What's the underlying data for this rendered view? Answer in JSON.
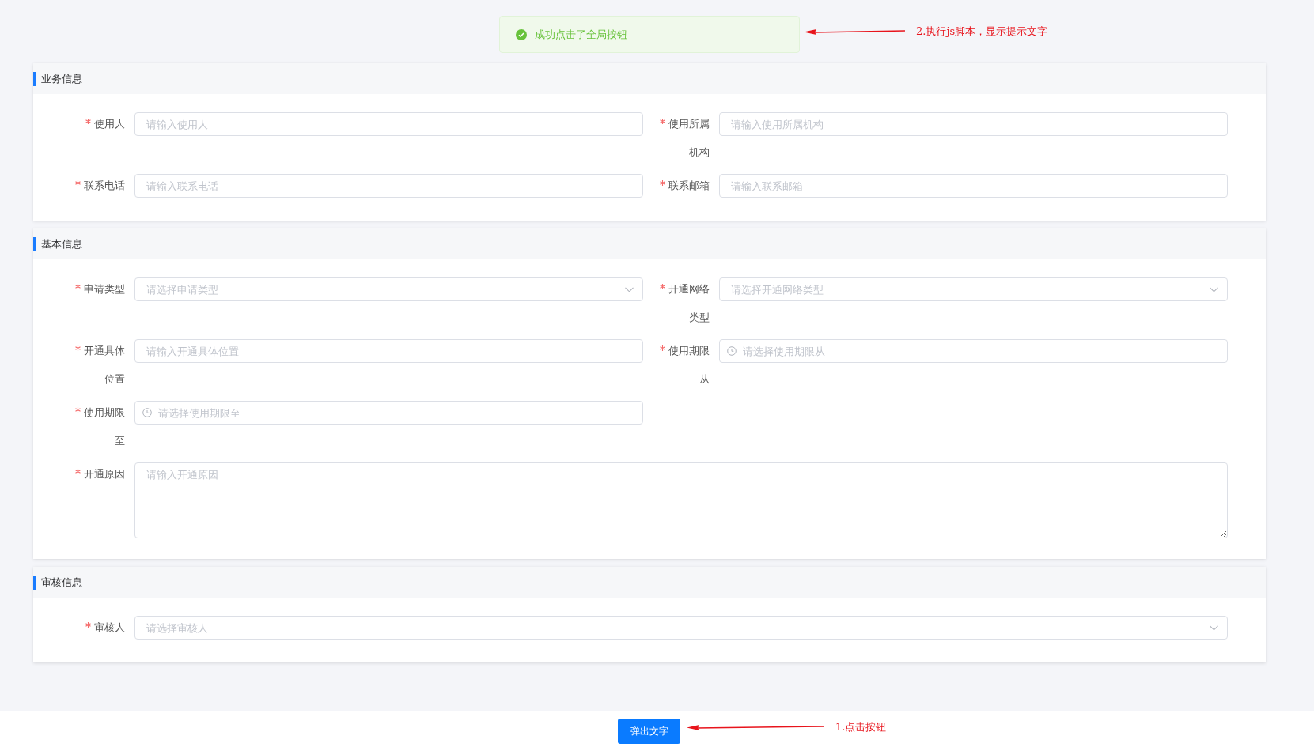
{
  "toast": {
    "kind": "success",
    "message": "成功点击了全局按钮"
  },
  "annotations": [
    {
      "text": "2.执行js脚本，显示提示文字"
    },
    {
      "text": "1.点击按钮"
    }
  ],
  "sections": [
    {
      "title": "业务信息",
      "fields": [
        {
          "label": "使用人",
          "required": true,
          "kind": "input",
          "placeholder": "请输入使用人"
        },
        {
          "label": "使用所属机构",
          "required": true,
          "kind": "input",
          "placeholder": "请输入使用所属机构"
        },
        {
          "label": "联系电话",
          "required": true,
          "kind": "input",
          "placeholder": "请输入联系电话"
        },
        {
          "label": "联系邮箱",
          "required": true,
          "kind": "input",
          "placeholder": "请输入联系邮箱"
        }
      ]
    },
    {
      "title": "基本信息",
      "fields": [
        {
          "label": "申请类型",
          "required": true,
          "kind": "select",
          "placeholder": "请选择申请类型"
        },
        {
          "label": "开通网络类型",
          "required": true,
          "kind": "select",
          "placeholder": "请选择开通网络类型"
        },
        {
          "label": "开通具体位置",
          "required": true,
          "kind": "input",
          "placeholder": "请输入开通具体位置"
        },
        {
          "label": "使用期限从",
          "required": true,
          "kind": "date",
          "placeholder": "请选择使用期限从"
        },
        {
          "label": "使用期限至",
          "required": true,
          "kind": "date",
          "placeholder": "请选择使用期限至"
        },
        {
          "label": "开通原因",
          "required": true,
          "kind": "textarea",
          "placeholder": "请输入开通原因"
        }
      ]
    },
    {
      "title": "审核信息",
      "fields": [
        {
          "label": "审核人",
          "required": true,
          "kind": "select",
          "placeholder": "请选择审核人"
        }
      ]
    }
  ],
  "footer": {
    "button": "弹出文字"
  }
}
